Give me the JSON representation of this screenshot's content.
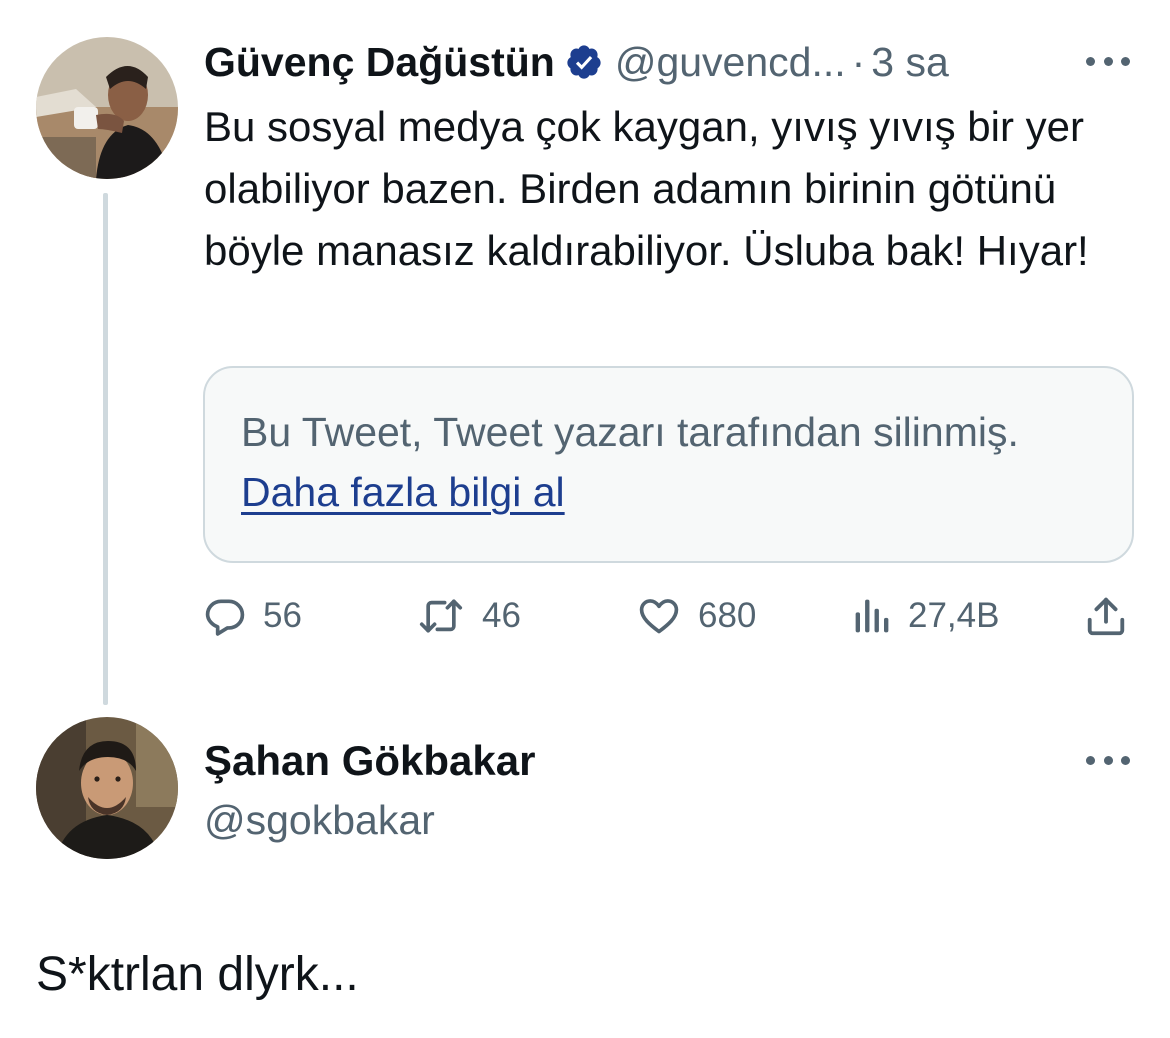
{
  "colors": {
    "text_primary": "#0f1419",
    "text_secondary": "#536471",
    "verified_badge": "#1d3e8f",
    "link": "#1d3e8f",
    "border": "#cfd9de",
    "card_bg": "#f7f9f9"
  },
  "tweet_main": {
    "author": {
      "display_name": "Güvenç Dağüstün",
      "verified_icon": "verified-badge-icon",
      "handle": "@guvencd...",
      "separator": "·",
      "time": "3 sa"
    },
    "text": "Bu sosyal medya çok kaygan, yıvış yıvış bir yer olabiliyor bazen. Birden adamın birinin götünü böyle manasız kaldırabiliyor. Üsluba bak! Hıyar!",
    "quoted_deleted": {
      "message": "Bu Tweet, Tweet yazarı tarafından silinmiş.",
      "link_text": "Daha fazla bilgi al"
    },
    "actions": {
      "replies": {
        "icon": "reply-icon",
        "count": "56"
      },
      "retweets": {
        "icon": "retweet-icon",
        "count": "46"
      },
      "likes": {
        "icon": "heart-icon",
        "count": "680"
      },
      "views": {
        "icon": "views-icon",
        "count": "27,4B"
      },
      "share": {
        "icon": "share-icon"
      }
    }
  },
  "tweet_reply": {
    "author": {
      "display_name": "Şahan Gökbakar",
      "handle": "@sgokbakar"
    },
    "text": "S*ktrlan dlyrk..."
  }
}
